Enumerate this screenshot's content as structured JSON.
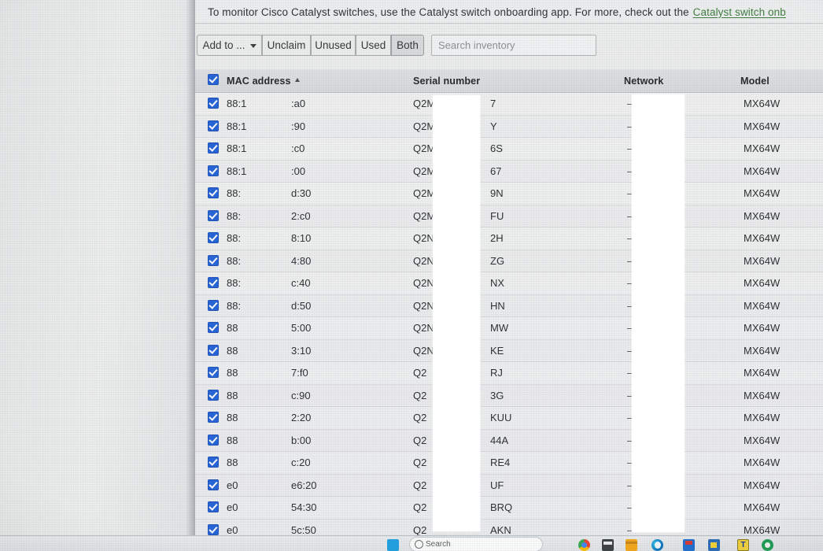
{
  "banner": {
    "text": "To monitor Cisco Catalyst switches, use the Catalyst switch onboarding app. For more, check out the",
    "link_text": "Catalyst switch onb"
  },
  "toolbar": {
    "add_to_label": "Add to ...",
    "unclaim_label": "Unclaim",
    "unused_label": "Unused",
    "used_label": "Used",
    "both_label": "Both",
    "selected_filter": "Both",
    "search_placeholder": "Search inventory",
    "search_value": ""
  },
  "table": {
    "columns": {
      "mac": "MAC address",
      "serial": "Serial number",
      "network": "Network",
      "model": "Model"
    },
    "sort_column": "MAC address",
    "sort_direction": "ascending",
    "header_checkbox_checked": true,
    "rows": [
      {
        "checked": true,
        "mac_prefix": "88:1",
        "mac_suffix": ":a0",
        "serial_prefix": "Q2M",
        "serial_suffix": "7",
        "network": "—",
        "model": "MX64W"
      },
      {
        "checked": true,
        "mac_prefix": "88:1",
        "mac_suffix": ":90",
        "serial_prefix": "Q2M",
        "serial_suffix": "Y",
        "network": "—",
        "model": "MX64W"
      },
      {
        "checked": true,
        "mac_prefix": "88:1",
        "mac_suffix": ":c0",
        "serial_prefix": "Q2M",
        "serial_suffix": "6S",
        "network": "—",
        "model": "MX64W"
      },
      {
        "checked": true,
        "mac_prefix": "88:1",
        "mac_suffix": ":00",
        "serial_prefix": "Q2M",
        "serial_suffix": "67",
        "network": "—",
        "model": "MX64W"
      },
      {
        "checked": true,
        "mac_prefix": "88:",
        "mac_suffix": "d:30",
        "serial_prefix": "Q2M",
        "serial_suffix": "9N",
        "network": "—",
        "model": "MX64W"
      },
      {
        "checked": true,
        "mac_prefix": "88:",
        "mac_suffix": "2:c0",
        "serial_prefix": "Q2M",
        "serial_suffix": "FU",
        "network": "—",
        "model": "MX64W"
      },
      {
        "checked": true,
        "mac_prefix": "88:",
        "mac_suffix": "8:10",
        "serial_prefix": "Q2N",
        "serial_suffix": "2H",
        "network": "—",
        "model": "MX64W"
      },
      {
        "checked": true,
        "mac_prefix": "88:",
        "mac_suffix": "4:80",
        "serial_prefix": "Q2N",
        "serial_suffix": "ZG",
        "network": "—",
        "model": "MX64W"
      },
      {
        "checked": true,
        "mac_prefix": "88:",
        "mac_suffix": "c:40",
        "serial_prefix": "Q2N",
        "serial_suffix": "NX",
        "network": "—",
        "model": "MX64W"
      },
      {
        "checked": true,
        "mac_prefix": "88:",
        "mac_suffix": "d:50",
        "serial_prefix": "Q2N",
        "serial_suffix": "HN",
        "network": "—",
        "model": "MX64W"
      },
      {
        "checked": true,
        "mac_prefix": "88",
        "mac_suffix": "5:00",
        "serial_prefix": "Q2N",
        "serial_suffix": "MW",
        "network": "—",
        "model": "MX64W"
      },
      {
        "checked": true,
        "mac_prefix": "88",
        "mac_suffix": "3:10",
        "serial_prefix": "Q2N",
        "serial_suffix": "KE",
        "network": "—",
        "model": "MX64W"
      },
      {
        "checked": true,
        "mac_prefix": "88",
        "mac_suffix": "7:f0",
        "serial_prefix": "Q2",
        "serial_suffix": "RJ",
        "network": "—",
        "model": "MX64W"
      },
      {
        "checked": true,
        "mac_prefix": "88",
        "mac_suffix": "c:90",
        "serial_prefix": "Q2",
        "serial_suffix": "3G",
        "network": "—",
        "model": "MX64W"
      },
      {
        "checked": true,
        "mac_prefix": "88",
        "mac_suffix": "2:20",
        "serial_prefix": "Q2",
        "serial_suffix": "KUU",
        "network": "—",
        "model": "MX64W"
      },
      {
        "checked": true,
        "mac_prefix": "88",
        "mac_suffix": "b:00",
        "serial_prefix": "Q2",
        "serial_suffix": "44A",
        "network": "—",
        "model": "MX64W"
      },
      {
        "checked": true,
        "mac_prefix": "88",
        "mac_suffix": "c:20",
        "serial_prefix": "Q2",
        "serial_suffix": "RE4",
        "network": "—",
        "model": "MX64W"
      },
      {
        "checked": true,
        "mac_prefix": "e0",
        "mac_suffix": "e6:20",
        "serial_prefix": "Q2",
        "serial_suffix": "UF",
        "network": "—",
        "model": "MX64W"
      },
      {
        "checked": true,
        "mac_prefix": "e0",
        "mac_suffix": "54:30",
        "serial_prefix": "Q2",
        "serial_suffix": "BRQ",
        "network": "—",
        "model": "MX64W"
      },
      {
        "checked": true,
        "mac_prefix": "e0",
        "mac_suffix": "5c:50",
        "serial_prefix": "Q2",
        "serial_suffix": "AKN",
        "network": "—",
        "model": "MX64W"
      }
    ]
  },
  "taskbar": {
    "search_placeholder": "Search",
    "icons": [
      "windows-start-icon",
      "chrome-icon",
      "dark-app-icon",
      "folder-icon",
      "edge-icon",
      "toolbox-icon",
      "blue-app-icon",
      "teams-t-icon",
      "green-circle-icon"
    ],
    "t_icon_label": "T"
  },
  "colors": {
    "checkbox_blue": "#2563d8",
    "link_green": "#3f7d3f",
    "header_bg": "#dfe0e2"
  }
}
